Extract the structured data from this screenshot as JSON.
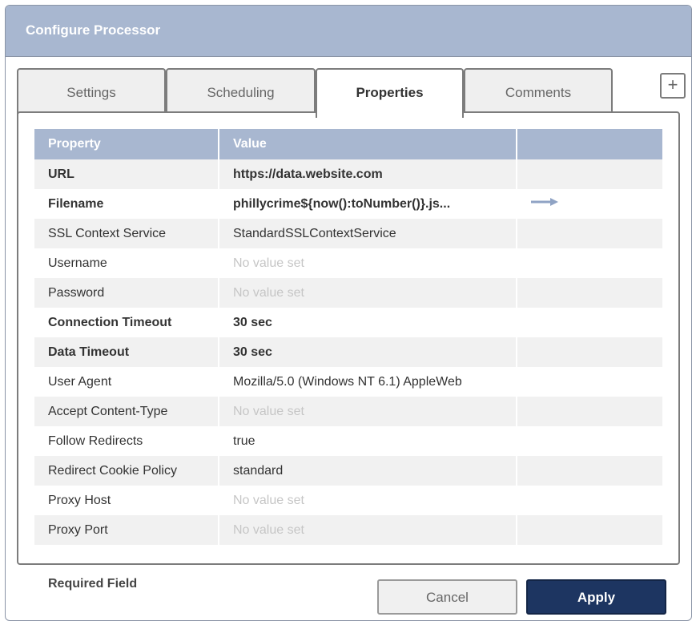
{
  "dialog": {
    "title": "Configure Processor"
  },
  "tabs": [
    {
      "label": "Settings",
      "active": false
    },
    {
      "label": "Scheduling",
      "active": false
    },
    {
      "label": "Properties",
      "active": true
    },
    {
      "label": "Comments",
      "active": false
    }
  ],
  "add_button": {
    "icon": "plus-icon",
    "label": "+"
  },
  "table": {
    "headers": [
      "Property",
      "Value",
      ""
    ],
    "rows": [
      {
        "property": "URL",
        "value": "https://data.website.com",
        "required": true,
        "empty": false
      },
      {
        "property": "Filename",
        "value": "phillycrime${now():toNumber()}.js...",
        "required": true,
        "empty": false,
        "action_icon": "arrow-right-icon"
      },
      {
        "property": "SSL Context Service",
        "value": "StandardSSLContextService",
        "required": false,
        "empty": false
      },
      {
        "property": "Username",
        "value": "No value set",
        "required": false,
        "empty": true
      },
      {
        "property": "Password",
        "value": "No value set",
        "required": false,
        "empty": true
      },
      {
        "property": "Connection Timeout",
        "value": "30 sec",
        "required": true,
        "empty": false
      },
      {
        "property": "Data Timeout",
        "value": "30 sec",
        "required": true,
        "empty": false
      },
      {
        "property": "User Agent",
        "value": "Mozilla/5.0 (Windows NT 6.1) AppleWeb",
        "required": false,
        "empty": false
      },
      {
        "property": "Accept Content-Type",
        "value": "No value set",
        "required": false,
        "empty": true
      },
      {
        "property": "Follow Redirects",
        "value": "true",
        "required": false,
        "empty": false
      },
      {
        "property": "Redirect Cookie Policy",
        "value": "standard",
        "required": false,
        "empty": false
      },
      {
        "property": "Proxy Host",
        "value": "No value set",
        "required": false,
        "empty": true
      },
      {
        "property": "Proxy Port",
        "value": "No value set",
        "required": false,
        "empty": true
      }
    ]
  },
  "footer": {
    "required_label": "Required Field",
    "cancel_label": "Cancel",
    "apply_label": "Apply"
  },
  "colors": {
    "header_bg": "#a8b7d0",
    "apply_bg": "#1d3561",
    "arrow": "#8fa3c4",
    "placeholder_text": "#c6c6c6"
  }
}
